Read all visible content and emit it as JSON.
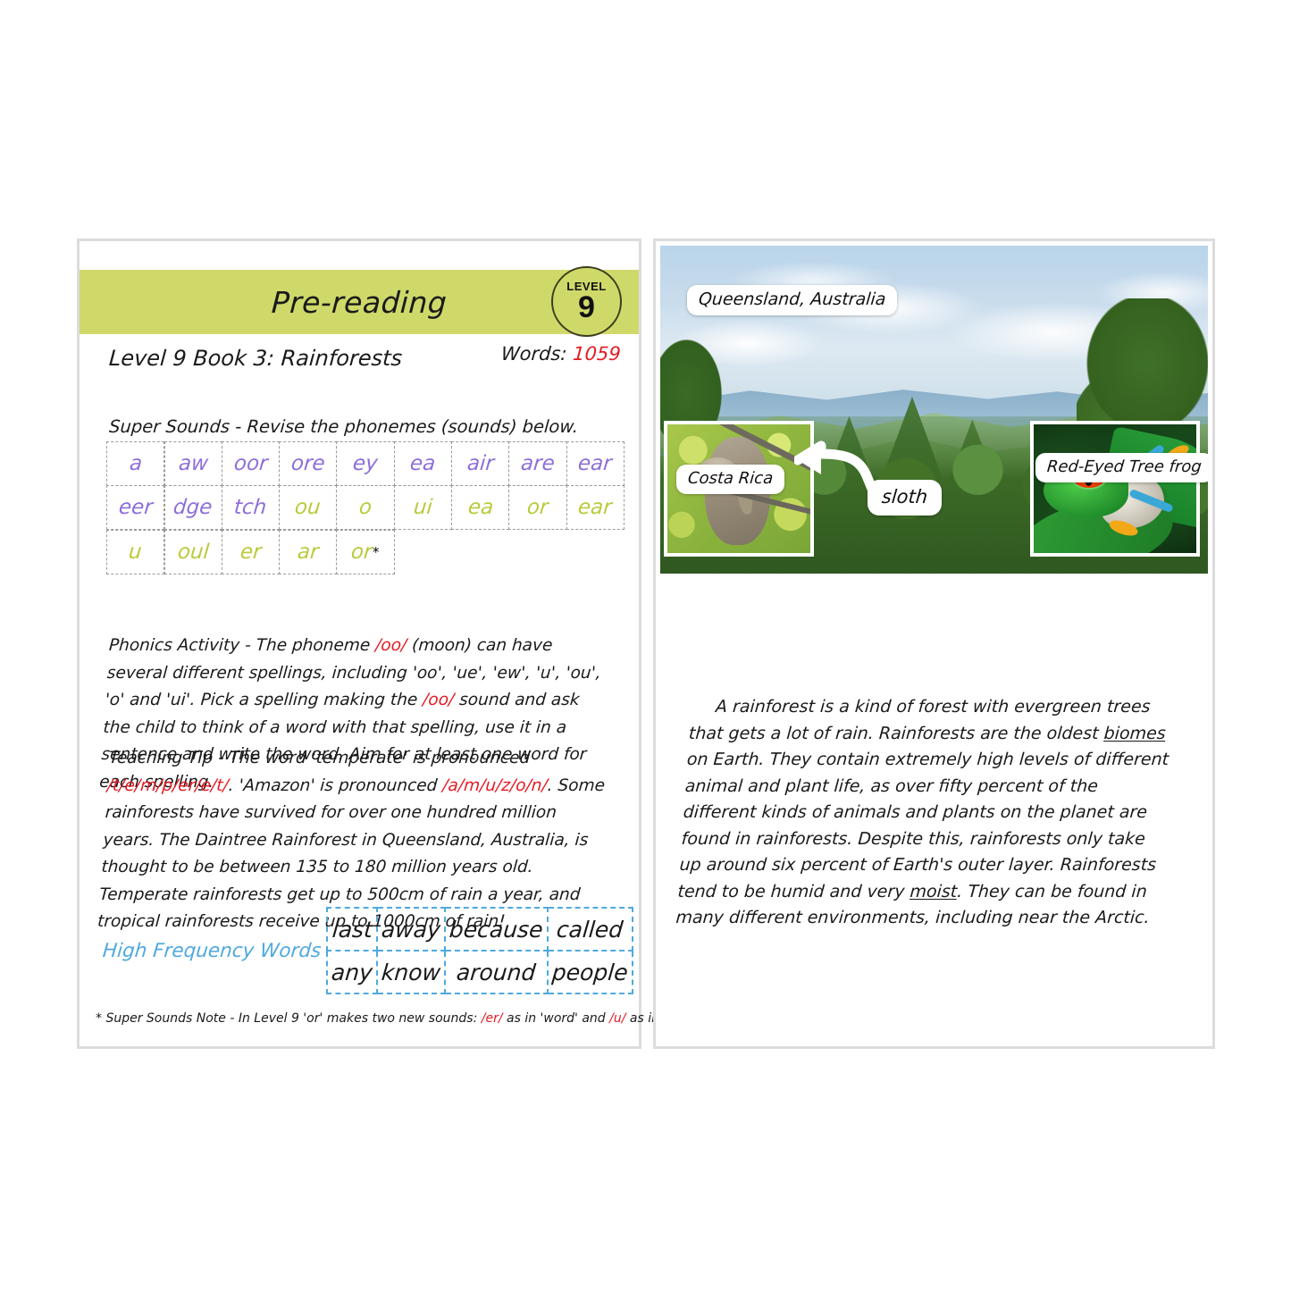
{
  "left_page": {
    "banner_title": "Pre-reading",
    "level_badge": {
      "word": "LEVEL",
      "number": "9"
    },
    "words_label": "Words: ",
    "words_count": "1059",
    "book_title": "Level 9 Book 3: Rainforests",
    "super_sounds_label": "Super Sounds - Revise the phonemes (sounds) below.",
    "phoneme_grid": {
      "rows": [
        [
          {
            "text": "a",
            "color": "purple"
          },
          {
            "text": "aw",
            "color": "purple"
          },
          {
            "text": "oor",
            "color": "purple"
          },
          {
            "text": "ore",
            "color": "purple"
          },
          {
            "text": "ey",
            "color": "purple"
          },
          {
            "text": "ea",
            "color": "purple"
          },
          {
            "text": "air",
            "color": "purple"
          },
          {
            "text": "are",
            "color": "purple"
          },
          {
            "text": "ear",
            "color": "purple"
          }
        ],
        [
          {
            "text": "eer",
            "color": "purple"
          },
          {
            "text": "dge",
            "color": "purple"
          },
          {
            "text": "tch",
            "color": "purple"
          },
          {
            "text": "ou",
            "color": "green"
          },
          {
            "text": "o",
            "color": "green"
          },
          {
            "text": "ui",
            "color": "green"
          },
          {
            "text": "ea",
            "color": "green"
          },
          {
            "text": "or",
            "color": "green"
          },
          {
            "text": "ear",
            "color": "green"
          }
        ],
        [
          {
            "text": "u",
            "color": "green"
          },
          {
            "text": "oul",
            "color": "green"
          },
          {
            "text": "er",
            "color": "green"
          },
          {
            "text": "ar",
            "color": "green"
          },
          {
            "text": "or",
            "color": "green",
            "star": "*"
          }
        ]
      ]
    },
    "phonics_activity": {
      "heading": "Phonics Activity - The phoneme ",
      "phoneme_1": "/oo/",
      "part_2": " (moon) can have several different spellings, including 'oo', 'ue', 'ew', 'u', 'ou', 'o' and 'ui'. Pick a spelling making the ",
      "phoneme_2": "/oo/",
      "part_3": " sound and ask the child to think of a word with that spelling, use it in a sentence and write the word. Aim for at least one word for each spelling."
    },
    "teaching_tip": {
      "part_1": "Teaching Tip - The word 'temperate' is pronounced ",
      "phoneme_1": "/t/e/m/p/er/e/t/",
      "part_2": ". 'Amazon' is pronounced ",
      "phoneme_2": "/a/m/u/z/o/n/",
      "part_3": ". Some rainforests have survived for over one hundred million years. The Daintree Rainforest in Queensland, Australia, is thought to be between 135 to 180 million years old. Temperate rainforests get up to 500cm of rain a year, and tropical rainforests receive up to 1000cm of rain!"
    },
    "high_frequency_words": {
      "label": "High Frequency Words",
      "rows": [
        [
          "last",
          "away",
          "because",
          "called"
        ],
        [
          "any",
          "know",
          "around",
          "people"
        ]
      ]
    },
    "footnote": {
      "part_1": "* Super Sounds Note - In Level 9 'or' makes two new sounds: ",
      "phoneme_1": "/er/",
      "part_2": " as in 'word' and ",
      "phoneme_2": "/u/",
      "part_3": " as in 'doctor'."
    }
  },
  "right_page": {
    "photo_labels": {
      "queensland": "Queensland, Australia",
      "costa_rica": "Costa Rica",
      "frog": "Red-Eyed Tree frog",
      "sloth": "sloth"
    },
    "body_text": {
      "part_1": "A rainforest is a kind of forest with evergreen trees that gets a lot of rain. Rainforests are the oldest ",
      "underlined_1": "biomes",
      "part_2": " on Earth. They contain extremely high levels of different animal and plant life, as over fifty percent of the different kinds of animals and plants on the planet are found in rainforests. Despite this, rainforests only take up around six percent of Earth's outer layer. Rainforests tend to be humid and very ",
      "underlined_2": "moist",
      "part_3": ". They can be found in many different environments, including near the Arctic."
    }
  },
  "colors": {
    "banner_green": "#cfd96a",
    "phoneme_purple": "#8e6fd8",
    "phoneme_green": "#b9cb3c",
    "accent_red": "#e31b23",
    "hfw_blue": "#4fa9de",
    "page_border": "#dcdcdc"
  }
}
